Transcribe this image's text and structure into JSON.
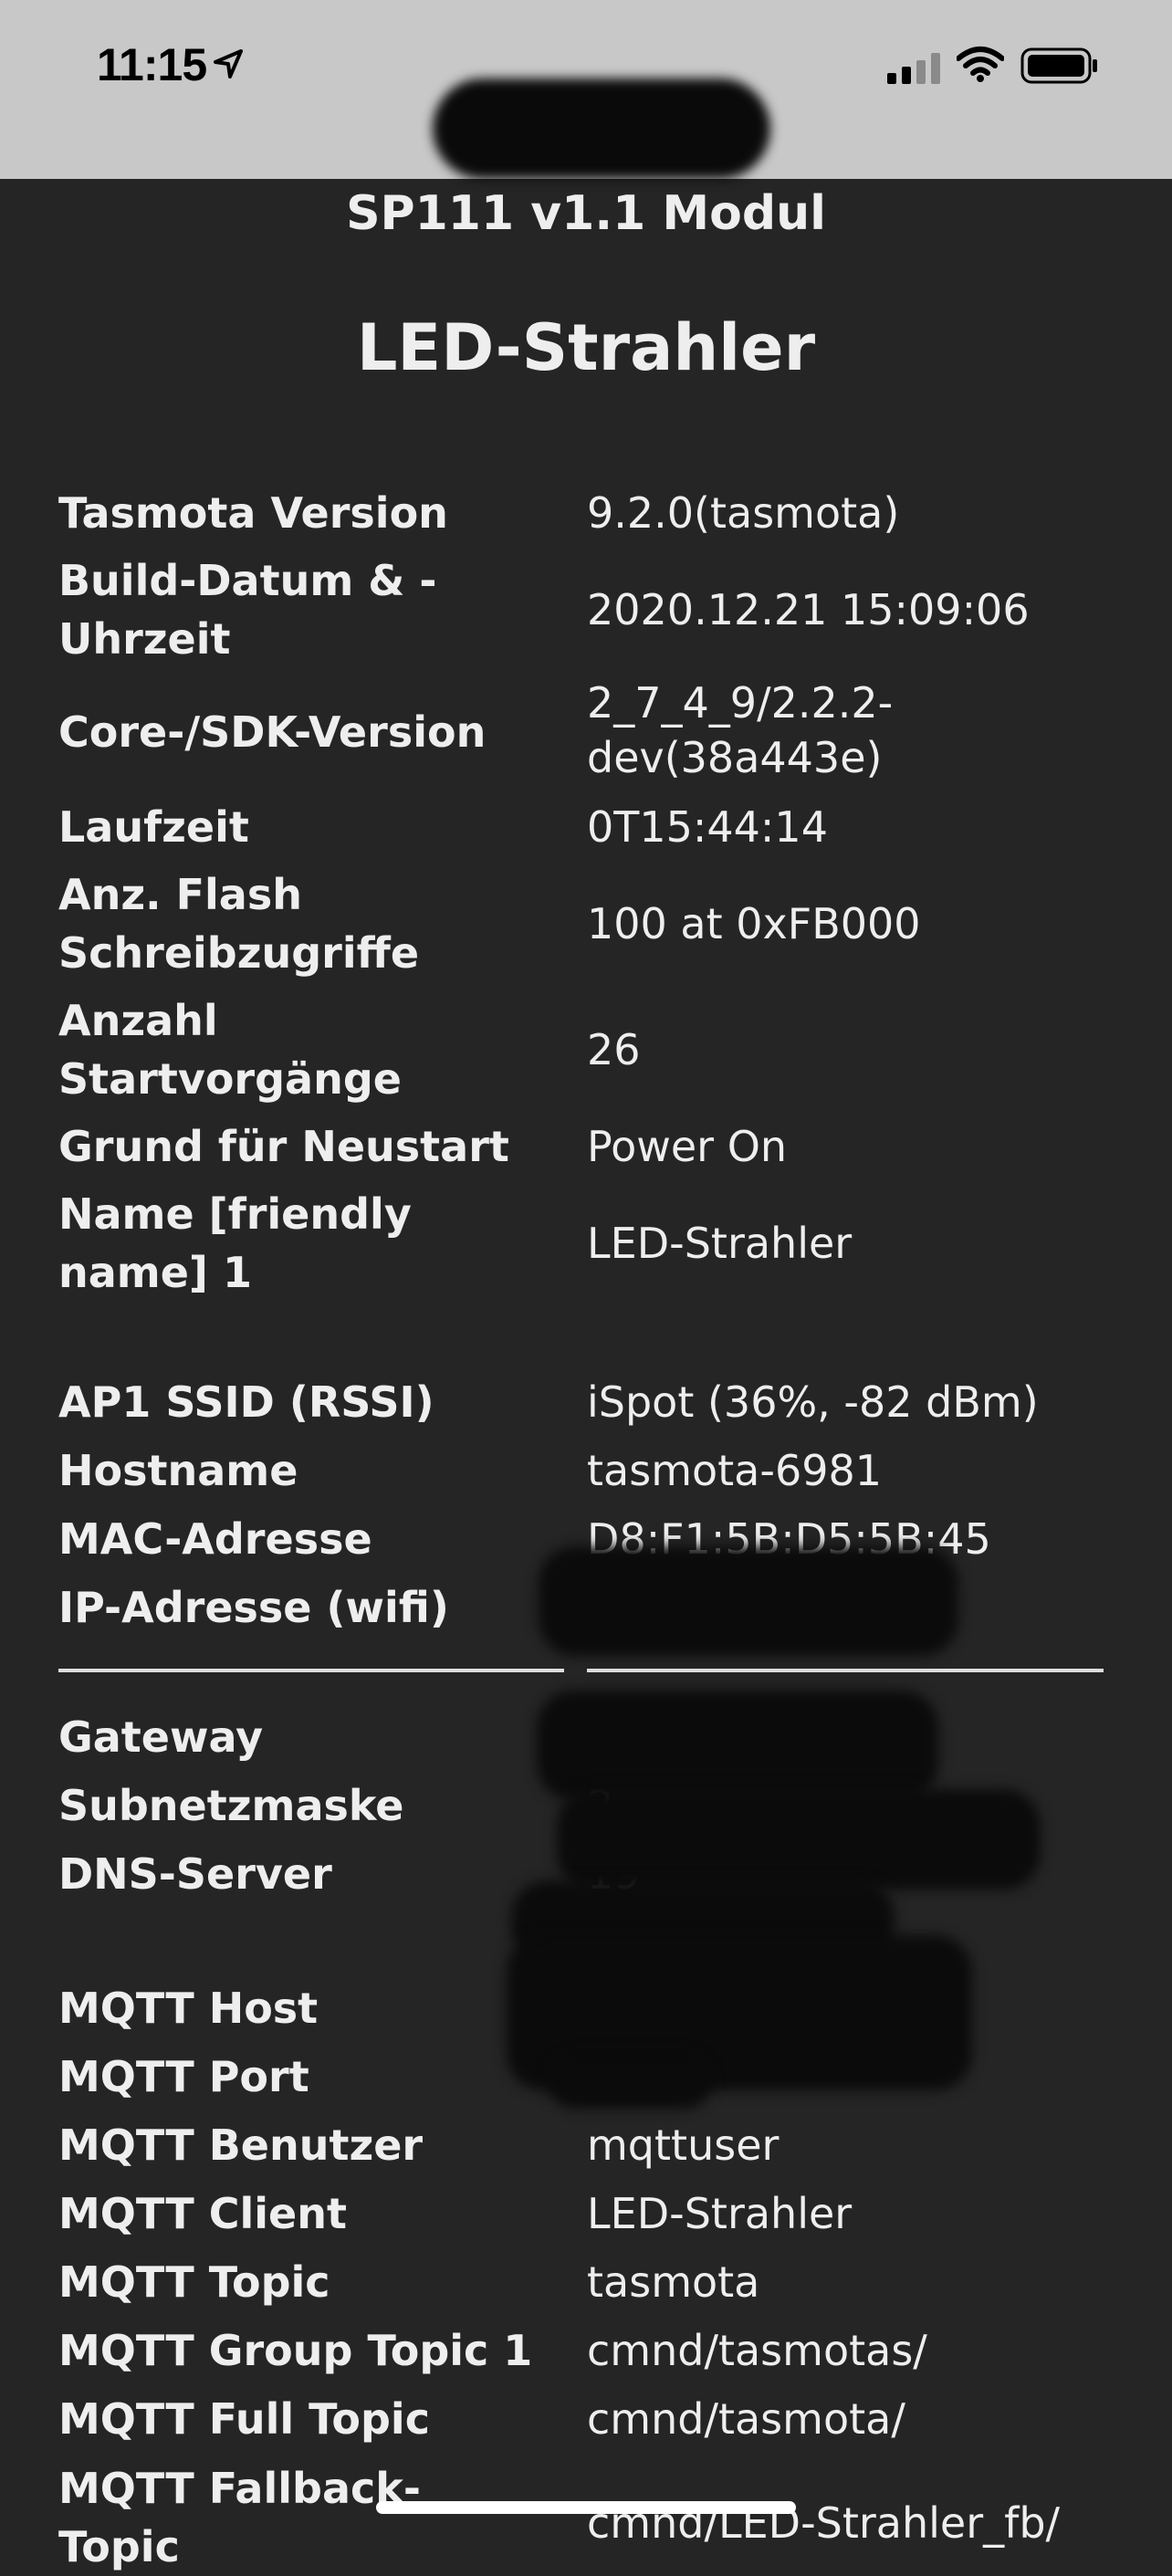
{
  "status_bar": {
    "time": "11:15",
    "icons": [
      "location-arrow-icon",
      "cellular-signal-icon",
      "wifi-icon",
      "battery-icon"
    ]
  },
  "header": {
    "module": "SP111 v1.1 Modul",
    "device": "LED-Strahler"
  },
  "info": {
    "tasmota_version": {
      "label": "Tasmota Version",
      "value": "9.2.0(tasmota)"
    },
    "build_date": {
      "label": "Build-Datum & - Uhrzeit",
      "value": "2020.12.21 15:09:06"
    },
    "core_sdk": {
      "label": "Core-/SDK-Version",
      "value": "2_7_4_9/2.2.2-dev(38a443e)"
    },
    "uptime": {
      "label": "Laufzeit",
      "value": "0T15:44:14"
    },
    "flash_writes": {
      "label": "Anz. Flash Schreibzugriffe",
      "value": "100 at 0xFB000"
    },
    "boot_count": {
      "label": "Anzahl Startvorgänge",
      "value": "26"
    },
    "restart_reason": {
      "label": "Grund für Neustart",
      "value": "Power On"
    },
    "friendly_name": {
      "label": "Name [friendly name] 1",
      "value": "LED-Strahler"
    },
    "ap1_ssid": {
      "label": "AP1 SSID (RSSI)",
      "value": "iSpot (36%, -82 dBm)"
    },
    "hostname": {
      "label": "Hostname",
      "value": "tasmota-6981"
    },
    "mac": {
      "label": "MAC-Adresse",
      "value": "D8:F1:5B:D5:5B:45"
    },
    "ip": {
      "label": "IP-Adresse (wifi)",
      "value": ""
    },
    "gateway": {
      "label": "Gateway",
      "value": ""
    },
    "subnet": {
      "label": "Subnetzmaske",
      "value": "2"
    },
    "dns": {
      "label": "DNS-Server",
      "value": "19"
    },
    "mqtt_host": {
      "label": "MQTT Host",
      "value": ""
    },
    "mqtt_port": {
      "label": "MQTT Port",
      "value": ""
    },
    "mqtt_user": {
      "label": "MQTT Benutzer",
      "value": "mqttuser"
    },
    "mqtt_client": {
      "label": "MQTT Client",
      "value": "LED-Strahler"
    },
    "mqtt_topic": {
      "label": "MQTT Topic",
      "value": "tasmota"
    },
    "mqtt_group": {
      "label": "MQTT Group Topic 1",
      "value": "cmnd/tasmotas/"
    },
    "mqtt_full": {
      "label": "MQTT Full Topic",
      "value": "cmnd/tasmota/"
    },
    "mqtt_fallback": {
      "label": "MQTT Fallback-Topic",
      "value": "cmnd/LED-Strahler_fb/"
    }
  }
}
